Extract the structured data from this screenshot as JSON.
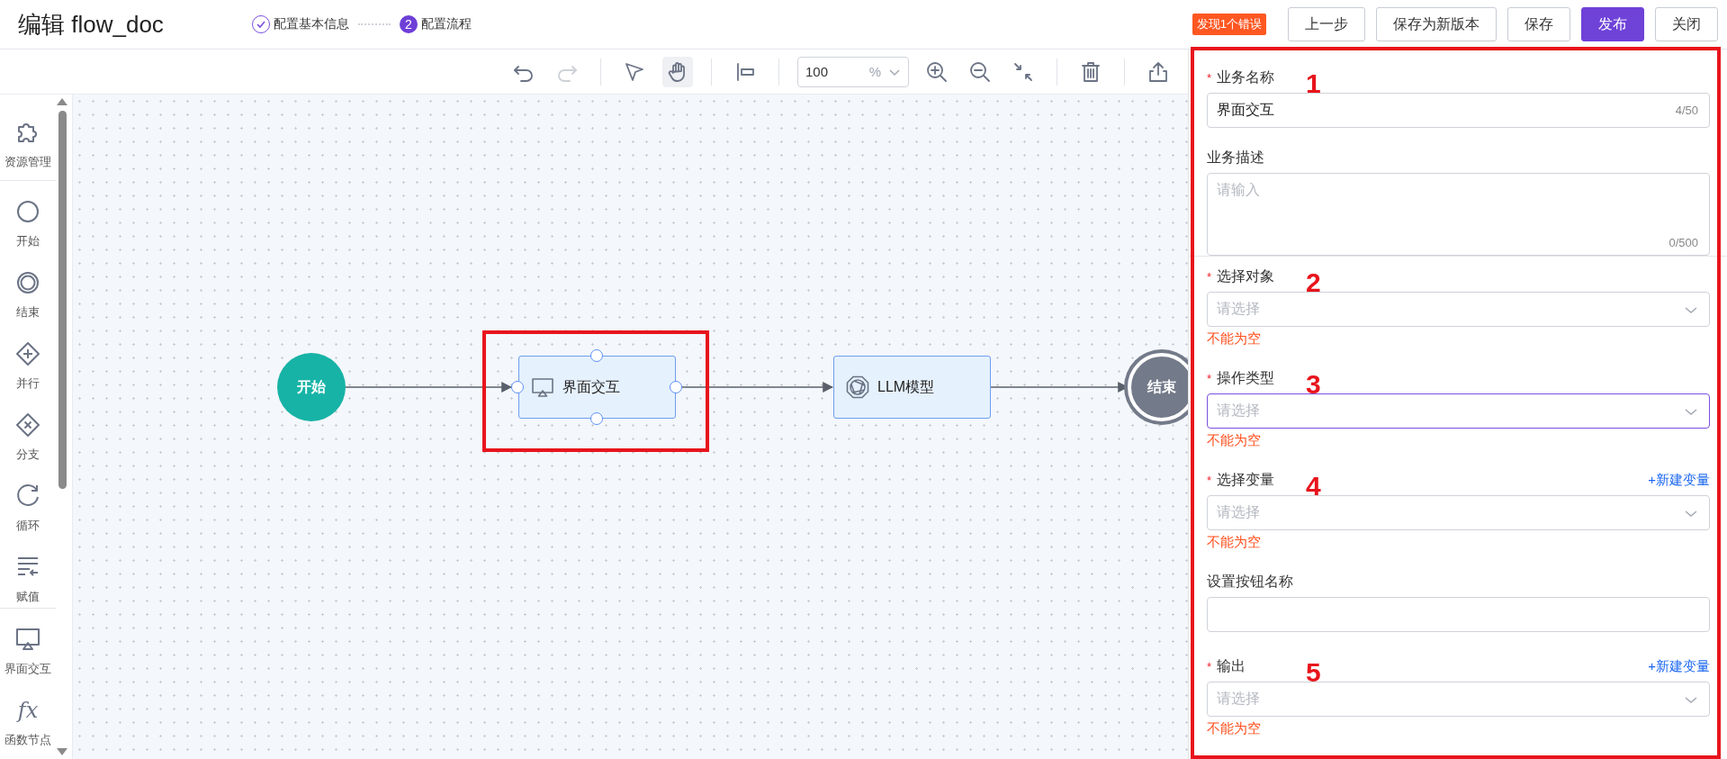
{
  "header": {
    "title": "编辑 flow_doc",
    "steps": [
      {
        "label": "配置基本信息",
        "done": true
      },
      {
        "label": "配置流程",
        "done": false,
        "number": "2"
      }
    ],
    "error_badge": "发现1个错误",
    "buttons": [
      {
        "label": "上一步",
        "primary": false
      },
      {
        "label": "保存为新版本",
        "primary": false
      },
      {
        "label": "保存",
        "primary": false
      },
      {
        "label": "发布",
        "primary": true
      },
      {
        "label": "关闭",
        "primary": false
      }
    ]
  },
  "toolbar": {
    "groups": [
      [
        {
          "kind": "undo",
          "selected": false,
          "disabled": false
        },
        {
          "kind": "redo",
          "selected": false,
          "disabled": true
        }
      ],
      [
        {
          "kind": "pointer",
          "selected": false,
          "disabled": false
        },
        {
          "kind": "hand",
          "selected": true,
          "disabled": false
        }
      ],
      [
        {
          "kind": "align",
          "selected": false,
          "disabled": false
        }
      ],
      [
        {
          "kind": "zoom_field",
          "value": "100",
          "unit": "%"
        },
        {
          "kind": "zoom_in",
          "selected": false,
          "disabled": false
        },
        {
          "kind": "zoom_out",
          "selected": false,
          "disabled": false
        },
        {
          "kind": "fit",
          "selected": false,
          "disabled": false
        }
      ],
      [
        {
          "kind": "delete",
          "selected": false,
          "disabled": false
        }
      ],
      [
        {
          "kind": "export",
          "selected": false,
          "disabled": false
        }
      ]
    ]
  },
  "sidebar": {
    "groups": [
      [
        {
          "kind": "resource",
          "label": "资源管理"
        }
      ],
      [
        {
          "kind": "start",
          "label": "开始"
        },
        {
          "kind": "end",
          "label": "结束"
        },
        {
          "kind": "parallel",
          "label": "并行"
        },
        {
          "kind": "branch",
          "label": "分支"
        },
        {
          "kind": "loop",
          "label": "循环"
        },
        {
          "kind": "assign",
          "label": "赋值"
        }
      ],
      [
        {
          "kind": "interaction",
          "label": "界面交互"
        },
        {
          "kind": "function",
          "icon_text": "fx",
          "label": "函数节点"
        }
      ]
    ]
  },
  "canvas": {
    "nodes": [
      {
        "kind": "start",
        "label": "开始"
      },
      {
        "kind": "interaction",
        "label": "界面交互",
        "selected": true,
        "annotated": true
      },
      {
        "kind": "llm",
        "label": "LLM模型",
        "selected": false
      },
      {
        "kind": "end",
        "label": "结束"
      }
    ]
  },
  "panel": {
    "annotated": true,
    "sections": [
      [
        {
          "kind": "text",
          "label": "业务名称",
          "required_mark": "*",
          "value": "界面交互",
          "counter": "4/50",
          "annotation": "1"
        },
        {
          "kind": "textarea",
          "label": "业务描述",
          "placeholder": "请输入",
          "counter": "0/500"
        }
      ],
      [
        {
          "kind": "select",
          "label": "选择对象",
          "required_mark": "*",
          "placeholder": "请选择",
          "error": "不能为空",
          "focused": false,
          "annotation": "2"
        },
        {
          "kind": "select",
          "label": "操作类型",
          "required_mark": "*",
          "placeholder": "请选择",
          "error": "不能为空",
          "focused": true,
          "annotation": "3"
        },
        {
          "kind": "select",
          "label": "选择变量",
          "required_mark": "*",
          "action": "+新建变量",
          "placeholder": "请选择",
          "error": "不能为空",
          "focused": false,
          "annotation": "4"
        },
        {
          "kind": "text",
          "label": "设置按钮名称"
        },
        {
          "kind": "select",
          "label": "输出",
          "required_mark": "*",
          "action": "+新建变量",
          "placeholder": "请选择",
          "error": "不能为空",
          "focused": false,
          "annotation": "5"
        }
      ]
    ]
  }
}
